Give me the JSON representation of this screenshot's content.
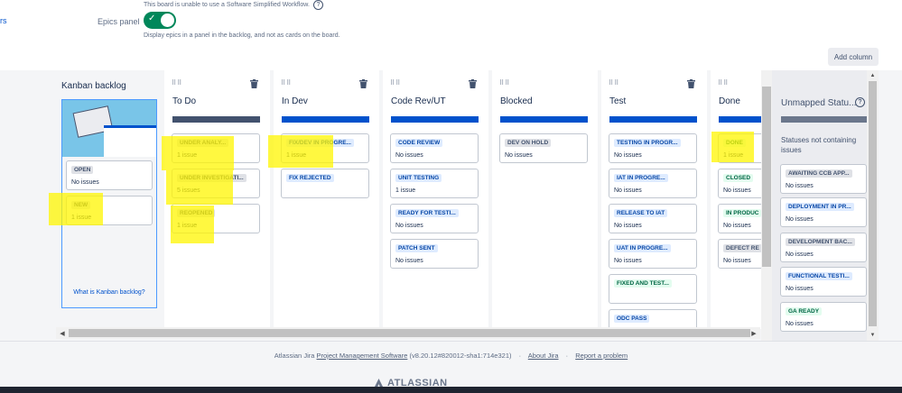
{
  "top": {
    "left_edge_label": "rs",
    "workflow_note": "This board is unable to use a Software Simplified Workflow.",
    "epics_label": "Epics panel",
    "epics_help": "Display epics in a panel in the backlog, and not as cards on the board.",
    "add_column": "Add column"
  },
  "backlog": {
    "title": "Kanban backlog",
    "cards": [
      {
        "status": "OPEN",
        "count": "No issues"
      },
      {
        "status": "NEW",
        "count": "1 issue"
      }
    ],
    "link": "What is Kanban backlog?"
  },
  "columns": [
    {
      "name": "To Do",
      "cards": [
        {
          "status": "UNDER ANALY...",
          "count": "1 issue"
        },
        {
          "status": "UNDER INVESTIGATI...",
          "count": "5 issues"
        },
        {
          "status": "REOPENED",
          "count": "1 issue"
        }
      ]
    },
    {
      "name": "In Dev",
      "cards": [
        {
          "status": "FIX/DEV IN PROGRE...",
          "count": "1 issue"
        },
        {
          "status": "FIX REJECTED",
          "count": ""
        }
      ]
    },
    {
      "name": "Code Rev/UT",
      "cards": [
        {
          "status": "CODE REVIEW",
          "count": "No issues"
        },
        {
          "status": "UNIT TESTING",
          "count": "1 issue"
        },
        {
          "status": "READY FOR TESTI...",
          "count": "No issues"
        },
        {
          "status": "PATCH SENT",
          "count": "No issues"
        }
      ]
    },
    {
      "name": "Blocked",
      "cards": [
        {
          "status": "DEV ON HOLD",
          "count": "No issues"
        }
      ]
    },
    {
      "name": "Test",
      "cards": [
        {
          "status": "TESTING IN PROGR...",
          "count": "No issues"
        },
        {
          "status": "IAT IN PROGRE...",
          "count": "No issues"
        },
        {
          "status": "RELEASE TO IAT",
          "count": "No issues"
        },
        {
          "status": "UAT IN PROGRE...",
          "count": "No issues"
        },
        {
          "status": "FIXED AND TEST...",
          "count": ""
        },
        {
          "status": "ODC PASS",
          "count": ""
        }
      ]
    },
    {
      "name": "Done",
      "cards": [
        {
          "status": "DONE",
          "count": "1 issue"
        },
        {
          "status": "CLOSED",
          "count": "No issues"
        },
        {
          "status": "IN PRODUC",
          "count": "No issues"
        },
        {
          "status": "DEFECT RE",
          "count": "No issues"
        }
      ]
    }
  ],
  "unmapped": {
    "title": "Unmapped Statu...",
    "description": "Statuses not containing issues",
    "cards": [
      {
        "status": "AWAITING CCB APP...",
        "count": "No issues"
      },
      {
        "status": "DEPLOYMENT IN PR...",
        "count": "No issues"
      },
      {
        "status": "DEVELOPMENT BAC...",
        "count": "No issues"
      },
      {
        "status": "FUNCTIONAL TESTI...",
        "count": "No issues"
      },
      {
        "status": "GA READY",
        "count": "No issues"
      }
    ]
  },
  "footer": {
    "prefix": "Atlassian Jira",
    "product_link": "Project Management Software",
    "version": "(v8.20.12#820012-sha1:714e321)",
    "about": "About Jira",
    "report": "Report a problem",
    "logo": "ATLASSIAN"
  },
  "colors": {
    "accent": "#0052cc",
    "toggle_on": "#00875a",
    "highlight": "#fff500"
  }
}
